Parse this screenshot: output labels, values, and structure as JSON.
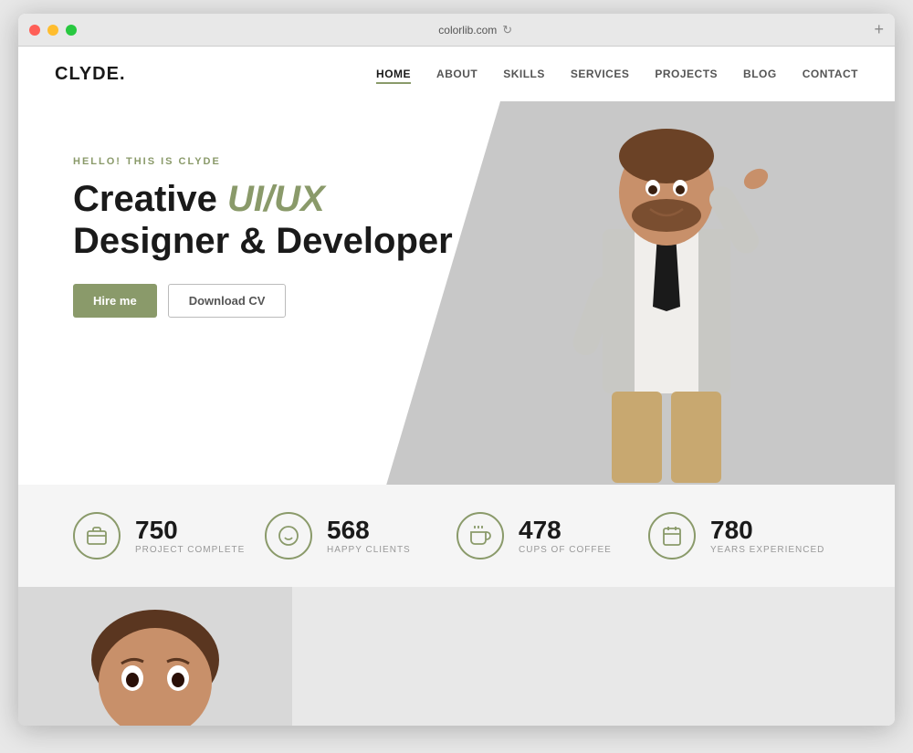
{
  "browser": {
    "url": "colorlib.com",
    "add_tab": "+"
  },
  "navbar": {
    "logo": "CLYDE.",
    "links": [
      {
        "label": "HOME",
        "active": true
      },
      {
        "label": "ABOUT",
        "active": false
      },
      {
        "label": "SKILLS",
        "active": false
      },
      {
        "label": "SERVICES",
        "active": false
      },
      {
        "label": "PROJECTS",
        "active": false
      },
      {
        "label": "BLOG",
        "active": false
      },
      {
        "label": "CONTACT",
        "active": false
      }
    ]
  },
  "hero": {
    "subtitle": "HELLO! THIS IS CLYDE",
    "title_part1": "Creative ",
    "title_highlight": "UI/UX",
    "title_part2": "Designer & Developer",
    "btn_hire": "Hire me",
    "btn_cv": "Download CV"
  },
  "stats": [
    {
      "number": "750",
      "label": "PROJECT COMPLETE",
      "icon": "briefcase"
    },
    {
      "number": "568",
      "label": "HAPPY CLIENTS",
      "icon": "smiley"
    },
    {
      "number": "478",
      "label": "CUPS OF COFFEE",
      "icon": "coffee"
    },
    {
      "number": "780",
      "label": "YEARS EXPERIENCED",
      "icon": "calendar"
    }
  ]
}
